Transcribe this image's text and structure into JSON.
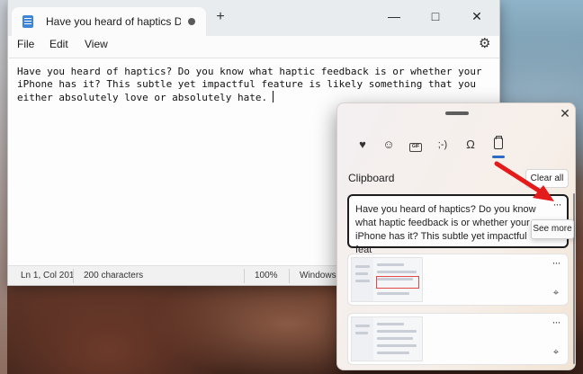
{
  "notepad": {
    "tab_title": "Have you heard of haptics Do you k",
    "add_tab_icon": "plus-icon",
    "window_controls": {
      "minimize": "—",
      "maximize": "□",
      "close": "✕"
    },
    "menu": {
      "file": "File",
      "edit": "Edit",
      "view": "View"
    },
    "settings_icon": "⚙",
    "body_text": "Have you heard of haptics? Do you know what haptic feedback is or whether your iPhone has it? This subtle yet impactful feature is likely something that you either absolutely love or absolutely hate.",
    "status": {
      "position": "Ln 1, Col 201",
      "characters": "200 characters",
      "zoom": "100%",
      "encoding": "Windows"
    }
  },
  "clipboard": {
    "close_glyph": "✕",
    "tabs": [
      {
        "icon": "sticker-heart-icon",
        "glyph": "♥"
      },
      {
        "icon": "emoji-icon",
        "glyph": "☺"
      },
      {
        "icon": "gif-icon",
        "glyph": "GIF"
      },
      {
        "icon": "kaomoji-icon",
        "glyph": ";-)"
      },
      {
        "icon": "symbols-icon",
        "glyph": "Ω"
      },
      {
        "icon": "clipboard-icon",
        "glyph": ""
      }
    ],
    "section_title": "Clipboard",
    "clear_all_label": "Clear all",
    "items": [
      {
        "text": "Have you heard of haptics? Do you know what haptic feedback is or whether your iPhone has it? This subtle yet impactful feat",
        "more": "···"
      },
      {
        "more": "···",
        "pin": "⌖"
      },
      {
        "more": "···",
        "pin": "⌖"
      }
    ],
    "tooltip": "See more"
  },
  "colors": {
    "accent": "#2b6bc8",
    "arrow": "#e31b1b",
    "highlight": "#e24848"
  }
}
